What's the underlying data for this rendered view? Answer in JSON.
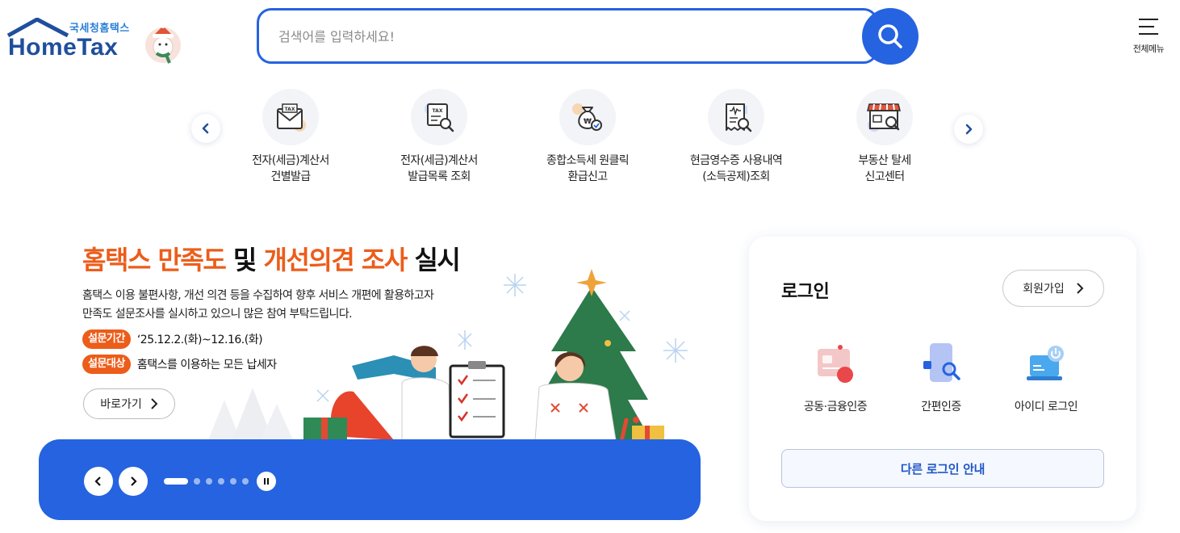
{
  "header": {
    "logo_kr": "국세청홈택스",
    "logo_en": "HomeTax",
    "search_placeholder": "검색어를 입력하세요!",
    "all_menu_label": "전체메뉴"
  },
  "quick_menu": {
    "items": [
      {
        "line1": "전자(세금)계산서",
        "line2": "건별발급",
        "icon": "tax-envelope-icon"
      },
      {
        "line1": "전자(세금)계산서",
        "line2": "발급목록 조회",
        "icon": "tax-document-search-icon"
      },
      {
        "line1": "종합소득세 원클릭",
        "line2": "환급신고",
        "icon": "money-bag-check-icon"
      },
      {
        "line1": "현금영수증 사용내역",
        "line2": "(소득공제)조회",
        "icon": "receipt-search-icon"
      },
      {
        "line1": "부동산 탈세",
        "line2": "신고센터",
        "icon": "store-search-icon"
      }
    ]
  },
  "banner": {
    "title_part1": "홈택스 만족도",
    "title_part2": "및",
    "title_part3": "개선의견 조사",
    "title_part4": "실시",
    "desc_line1": "홈택스 이용 불편사항, 개선 의견 등을 수집하여 향후 서비스 개편에 활용하고자",
    "desc_line2": "만족도 설문조사를 실시하고 있으니 많은 참여 부탁드립니다.",
    "period_label": "설문기간",
    "period_value": "‘25.12.2.(화)~12.16.(화)",
    "target_label": "설문대상",
    "target_value": "홈택스를 이용하는 모든 납세자",
    "goto_label": "바로가기",
    "slide_count": 6,
    "active_slide": 1
  },
  "login": {
    "title": "로그인",
    "signup_label": "회원가입",
    "options": [
      {
        "label": "공동·금융인증",
        "icon": "certificate-card-icon"
      },
      {
        "label": "간편인증",
        "icon": "phone-auth-icon"
      },
      {
        "label": "아이디 로그인",
        "icon": "laptop-power-icon"
      }
    ],
    "other_login_label": "다른 로그인 안내"
  },
  "colors": {
    "primary": "#2563e0",
    "accent_orange": "#ec5d1a",
    "logo_navy": "#1f4f9c"
  }
}
